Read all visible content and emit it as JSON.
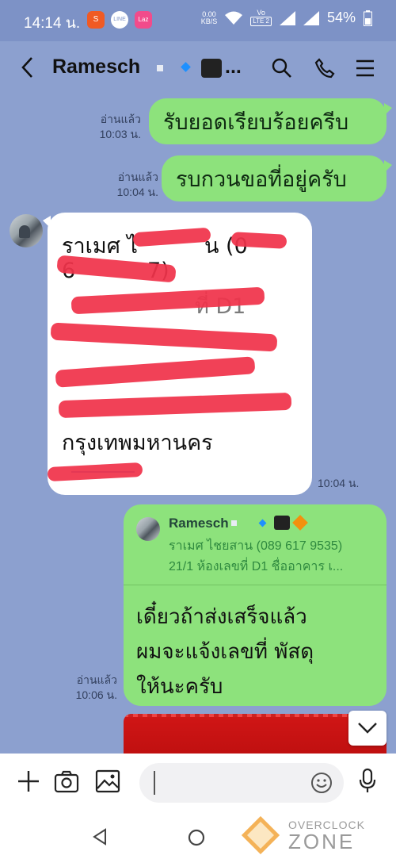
{
  "status_bar": {
    "time": "14:14 น.",
    "net_speed": "0.00",
    "net_unit": "KB/S",
    "volte_top": "Vo",
    "volte_bottom": "LTE 2",
    "battery": "54%",
    "apps": [
      {
        "icon": "shopee-icon",
        "label": "S",
        "color": "#f05a24"
      },
      {
        "icon": "line-icon",
        "label": "LINE",
        "color": "#ffffff"
      },
      {
        "icon": "lazada-icon",
        "label": "Laz",
        "color": "#f24b8b"
      }
    ]
  },
  "header": {
    "back_icon": "back-arrow-icon",
    "chat_name": "Ramesch",
    "ellipsis": "...",
    "search_icon": "search-icon",
    "call_icon": "phone-icon",
    "menu_icon": "menu-icon"
  },
  "messages": [
    {
      "type": "outgoing",
      "text": "รับยอดเรียบร้อยครีบ",
      "read": "อ่านแล้ว",
      "time": "10:03 น."
    },
    {
      "type": "outgoing",
      "text": "รบกวนขอที่อยู่ครับ",
      "read": "อ่านแล้ว",
      "time": "10:04 น."
    }
  ],
  "incoming": {
    "lines": [
      "ราเมศ ไ",
      "น (0",
      "6",
      "7)",
      "ที่ D1",
      "กรุงเทพมหานคร"
    ],
    "time": "10:04 น."
  },
  "reply": {
    "quote_name": "Ramesch",
    "quote_line1": "ราเมศ ไชยสาน (089 617 9535)",
    "quote_line2": "21/1 ห้องเลขที่ D1 ชื่ออาคาร เ...",
    "text_lines": [
      "เดี๋ยวถ้าส่งเสร็จแล้ว",
      "ผมจะแจ้งเลขที่ พัสดุ",
      "ให้นะครับ"
    ],
    "read": "อ่านแล้ว",
    "time": "10:06 น."
  },
  "composer": {
    "placeholder": "",
    "add_icon": "plus-icon",
    "camera_icon": "camera-icon",
    "image_icon": "image-icon",
    "emoji_icon": "emoji-icon",
    "mic_icon": "microphone-icon"
  },
  "watermark": {
    "top": "OVERCLOCK",
    "bottom": "ZONE"
  },
  "colors": {
    "chat_bg": "#8ca0cf",
    "outgoing_bubble": "#8de27c",
    "incoming_bubble": "#ffffff",
    "redaction": "#f0334a"
  }
}
